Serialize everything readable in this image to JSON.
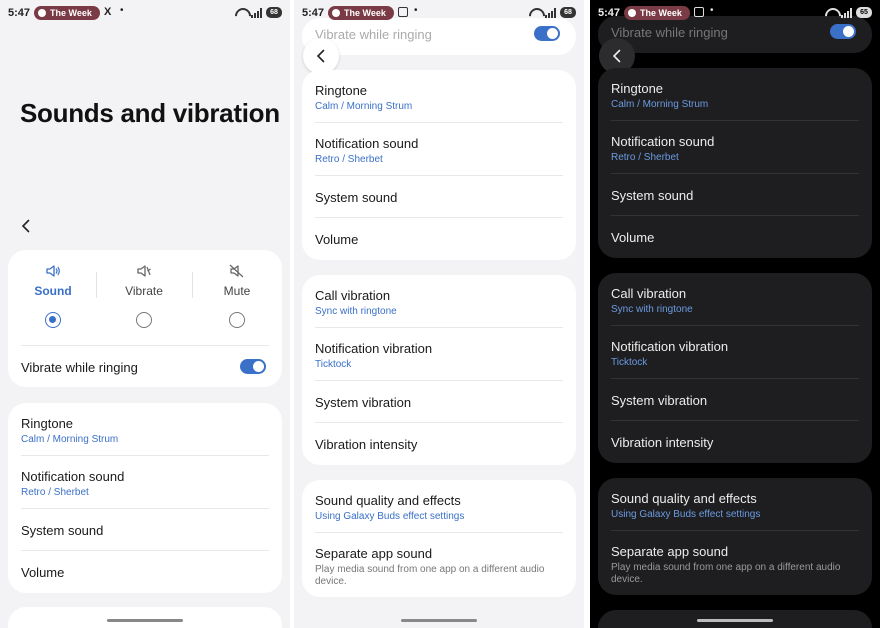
{
  "status": {
    "time": "5:47",
    "chip": "The Week",
    "x_glyph": "X",
    "dot": "•",
    "battery": [
      "68",
      "68",
      "65"
    ]
  },
  "panel1": {
    "page_title": "Sounds and vibration",
    "modes": [
      {
        "label": "Sound",
        "icon": "speaker-icon",
        "selected": true
      },
      {
        "label": "Vibrate",
        "icon": "vibrate-icon",
        "selected": false
      },
      {
        "label": "Mute",
        "icon": "mute-icon",
        "selected": false
      }
    ],
    "vibrate_while_ringing": "Vibrate while ringing",
    "rows": [
      {
        "title": "Ringtone",
        "sub": "Calm / Morning Strum"
      },
      {
        "title": "Notification sound",
        "sub": "Retro / Sherbet"
      },
      {
        "title": "System sound"
      },
      {
        "title": "Volume"
      }
    ]
  },
  "scrolled": {
    "vibrate_while_ringing": "Vibrate while ringing",
    "group1": [
      {
        "title": "Ringtone",
        "sub": "Calm / Morning Strum"
      },
      {
        "title": "Notification sound",
        "sub": "Retro / Sherbet"
      },
      {
        "title": "System sound"
      },
      {
        "title": "Volume"
      }
    ],
    "group2": [
      {
        "title": "Call vibration",
        "sub": "Sync with ringtone"
      },
      {
        "title": "Notification vibration",
        "sub": "Ticktock"
      },
      {
        "title": "System vibration"
      },
      {
        "title": "Vibration intensity"
      }
    ],
    "group3": [
      {
        "title": "Sound quality and effects",
        "sub": "Using Galaxy Buds effect settings"
      },
      {
        "title": "Separate app sound",
        "desc": "Play media sound from one app on a different audio device."
      }
    ]
  },
  "colors": {
    "accent": "#3a70c8",
    "dark_bg": "#000000",
    "dark_card": "#1e1e20",
    "light_bg": "#f3f3f5"
  }
}
